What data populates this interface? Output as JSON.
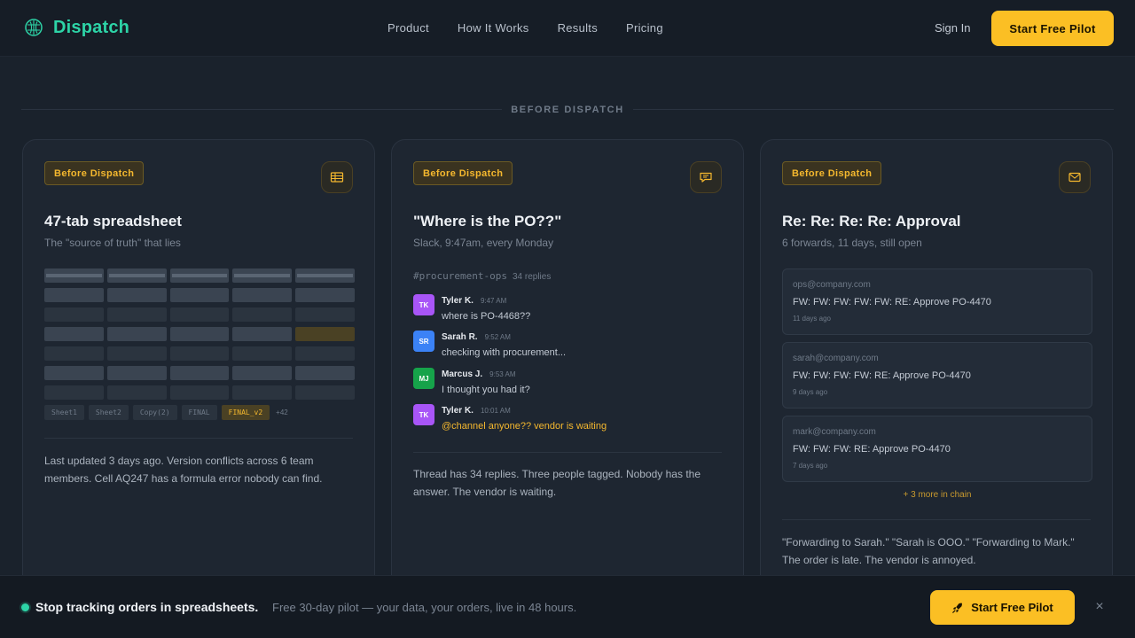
{
  "nav": {
    "brand": "Dispatch",
    "links": [
      "Product",
      "How It Works",
      "Results",
      "Pricing"
    ],
    "sign_in": "Sign In",
    "cta": "Start Free Pilot"
  },
  "section_label": "BEFORE DISPATCH",
  "cards": [
    {
      "badge": "Before Dispatch",
      "icon": "spreadsheet-icon",
      "title": "47-tab spreadsheet",
      "subtitle": "The \"source of truth\" that lies",
      "sheet_tabs": [
        "Sheet1",
        "Sheet2",
        "Copy(2)",
        "FINAL",
        "FINAL_v2"
      ],
      "sheet_tabs_more": "+42",
      "description": "Last updated 3 days ago. Version conflicts across 6 team members. Cell AQ247 has a formula error nobody can find."
    },
    {
      "badge": "Before Dispatch",
      "icon": "chat-icon",
      "title": "\"Where is the PO??\"",
      "subtitle": "Slack, 9:47am, every Monday",
      "channel": "#procurement-ops",
      "replies": "34 replies",
      "messages": [
        {
          "initials": "TK",
          "name": "Tyler K.",
          "time": "9:47 AM",
          "text": "where is PO-4468??",
          "color": "#a855f7"
        },
        {
          "initials": "SR",
          "name": "Sarah R.",
          "time": "9:52 AM",
          "text": "checking with procurement...",
          "color": "#3b82f6"
        },
        {
          "initials": "MJ",
          "name": "Marcus J.",
          "time": "9:53 AM",
          "text": "I thought you had it?",
          "color": "#16a34a"
        },
        {
          "initials": "TK",
          "name": "Tyler K.",
          "time": "10:01 AM",
          "text": "@channel anyone?? vendor is waiting",
          "color": "#a855f7"
        }
      ],
      "description": "Thread has 34 replies. Three people tagged. Nobody has the answer. The vendor is waiting."
    },
    {
      "badge": "Before Dispatch",
      "icon": "mail-icon",
      "title": "Re: Re: Re: Re: Approval",
      "subtitle": "6 forwards, 11 days, still open",
      "emails": [
        {
          "from": "ops@company.com",
          "subject": "FW: FW: FW: FW: FW: RE: Approve PO-4470",
          "age": "11 days ago"
        },
        {
          "from": "sarah@company.com",
          "subject": "FW: FW: FW: FW: RE: Approve PO-4470",
          "age": "9 days ago"
        },
        {
          "from": "mark@company.com",
          "subject": "FW: FW: FW: RE: Approve PO-4470",
          "age": "7 days ago"
        }
      ],
      "more_chain": "+ 3 more in chain",
      "description": "\"Forwarding to Sarah.\" \"Sarah is OOO.\" \"Forwarding to Mark.\" The order is late. The vendor is annoyed."
    }
  ],
  "bottom_bar": {
    "title": "Stop tracking orders in spreadsheets.",
    "subtitle": "Free 30-day pilot — your data, your orders, live in 48 hours.",
    "cta": "Start Free Pilot",
    "close": "×"
  },
  "colors": {
    "accent": "#fbbf24",
    "brand": "#2dd4a7",
    "badge_text": "#f5b82e"
  }
}
